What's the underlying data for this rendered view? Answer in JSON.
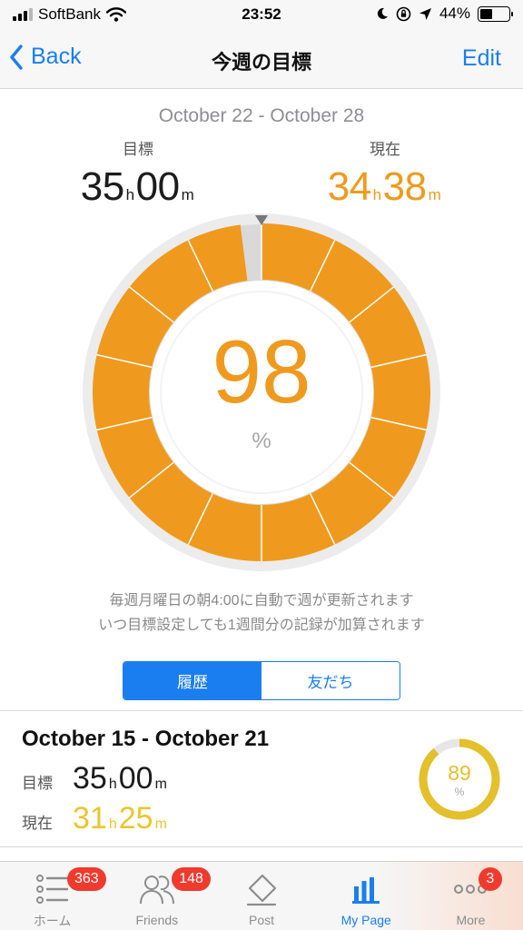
{
  "status_bar": {
    "carrier": "SoftBank",
    "time": "23:52",
    "battery_percent": "44%",
    "battery_level": 0.44,
    "icons": [
      "signal-bars-icon",
      "wifi-icon",
      "moon-icon",
      "orientation-lock-icon",
      "location-arrow-icon",
      "battery-icon"
    ]
  },
  "nav": {
    "back_label": "Back",
    "title": "今週の目標",
    "edit_label": "Edit"
  },
  "week": {
    "range": "October 22 - October 28",
    "goal_label": "目標",
    "goal_hours": "35",
    "goal_minutes": "00",
    "current_label": "現在",
    "current_hours": "34",
    "current_minutes": "38",
    "hours_unit": "h",
    "minutes_unit": "m",
    "percent": "98",
    "percent_fraction": 0.98,
    "percent_unit": "%",
    "accent_color": "#ef9a1e"
  },
  "note": {
    "line1": "毎週月曜日の朝4:00に自動で週が更新されます",
    "line2": "いつ目標設定しても1週間分の記録が加算されます"
  },
  "segmented": {
    "history_label": "履歴",
    "friends_label": "友だち",
    "selected": "履歴"
  },
  "history": {
    "range": "October 15 - October 21",
    "goal_label": "目標",
    "goal_hours": "35",
    "goal_minutes": "00",
    "current_label": "現在",
    "current_hours": "31",
    "current_minutes": "25",
    "hours_unit": "h",
    "minutes_unit": "m",
    "percent": "89",
    "percent_fraction": 0.89,
    "percent_unit": "%",
    "accent_color": "#e3c02c"
  },
  "tabs": [
    {
      "label": "ホーム",
      "badge": "363",
      "icon": "list-icon",
      "active": false
    },
    {
      "label": "Friends",
      "badge": "148",
      "icon": "friends-icon",
      "active": false
    },
    {
      "label": "Post",
      "badge": "",
      "icon": "post-icon",
      "active": false
    },
    {
      "label": "My Page",
      "badge": "",
      "icon": "bar-chart-icon",
      "active": true
    },
    {
      "label": "More",
      "badge": "3",
      "icon": "more-dots-icon",
      "active": false
    }
  ]
}
